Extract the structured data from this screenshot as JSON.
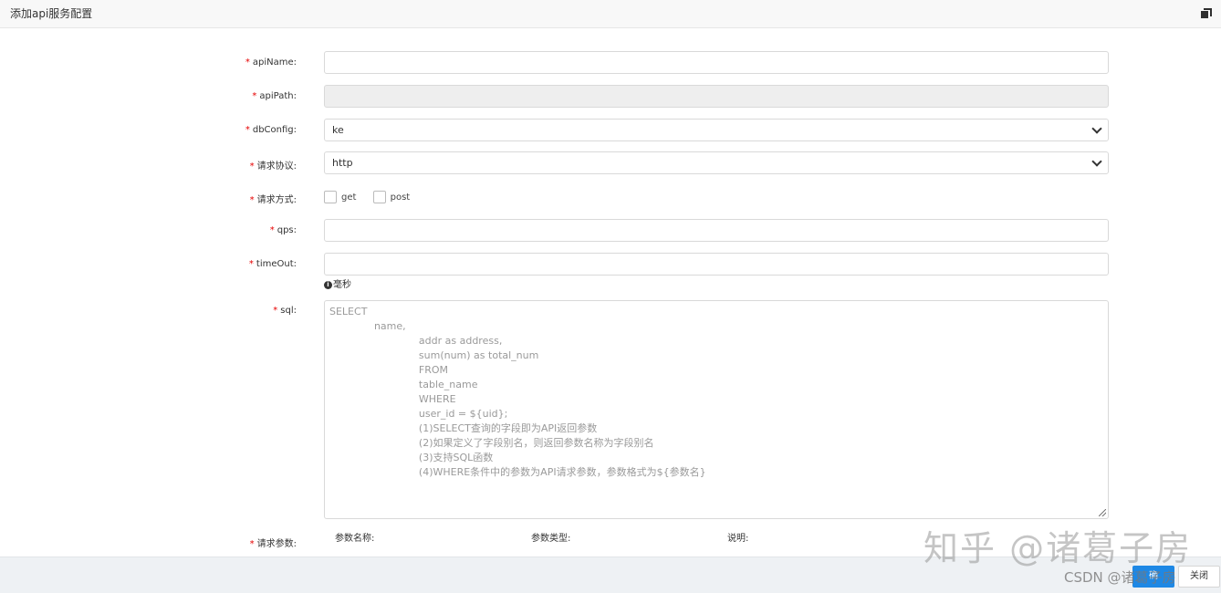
{
  "window": {
    "title": "添加api服务配置",
    "restore_icon": "restore-window-icon"
  },
  "form": {
    "required_mark": "*",
    "apiName": {
      "label": "apiName:",
      "value": ""
    },
    "apiPath": {
      "label": "apiPath:",
      "value": ""
    },
    "dbConfig": {
      "label": "dbConfig:",
      "value": "ke"
    },
    "protocol": {
      "label": "请求协议:",
      "value": "http"
    },
    "method": {
      "label": "请求方式:",
      "options": [
        "get",
        "post"
      ]
    },
    "qps": {
      "label": "qps:",
      "value": ""
    },
    "timeout": {
      "label": "timeOut:",
      "value": "",
      "hint": "毫秒"
    },
    "sql": {
      "label": "sql:",
      "placeholder_lines": [
        "SELECT",
        "              name,",
        "                            addr as address,",
        "                            sum(num) as total_num",
        "                            FROM",
        "                            table_name",
        "                            WHERE",
        "                            user_id = ${uid};",
        "                            (1)SELECT查询的字段即为API返回参数",
        "                            (2)如果定义了字段别名，则返回参数名称为字段别名",
        "                            (3)支持SQL函数",
        "                            (4)WHERE条件中的参数为API请求参数，参数格式为${参数名}"
      ]
    },
    "params": {
      "label": "请求参数:",
      "columns": [
        "参数名称:",
        "参数类型:",
        "说明:"
      ]
    }
  },
  "footer": {
    "confirm_label": "确",
    "close_label": "关闭"
  },
  "watermarks": {
    "large": "知乎 @诸葛子房",
    "small": "CSDN @诸葛子房"
  }
}
